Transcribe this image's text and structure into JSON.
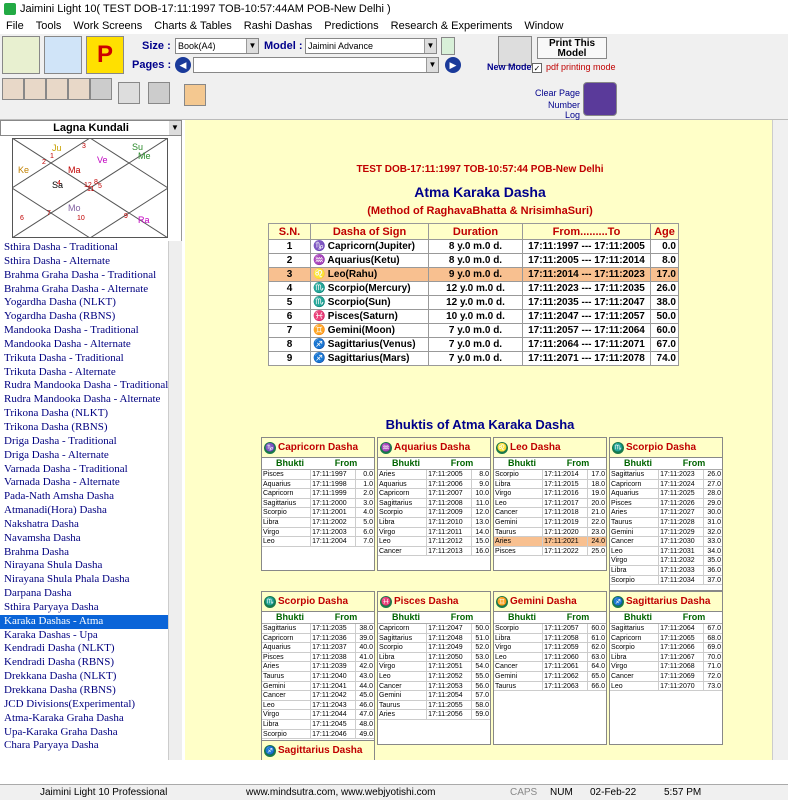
{
  "window": {
    "title": "Jaimini Light 10( TEST DOB-17:11:1997 TOB-10:57:44AM POB-New Delhi )"
  },
  "menu": [
    "File",
    "Tools",
    "Work Screens",
    "Charts & Tables",
    "Rashi Dashas",
    "Predictions",
    "Research & Experiments",
    "Window"
  ],
  "toolbar": {
    "size_label": "Size :",
    "size_value": "Book(A4)",
    "model_label": "Model :",
    "model_value": "Jaimini Advance",
    "pages_label": "Pages :",
    "print_label": "Print This Model",
    "new_model": "New Model",
    "pdf_label": "pdf printing mode",
    "clear_page": "Clear Page",
    "number_log": "Number Log"
  },
  "sidebar": {
    "lagna": "Lagna Kundali",
    "planets": [
      "Ju",
      "Su",
      "Me",
      "Ve",
      "Ke",
      "Ma",
      "Sa",
      "Mo",
      "Ra"
    ],
    "houses": [
      "3",
      "1",
      "2",
      "4",
      "12",
      "8",
      "5",
      "11",
      "6",
      "10",
      "7",
      "9"
    ],
    "dashas": [
      "Sthira Dasha - Traditional",
      "Sthira Dasha - Alternate",
      "Brahma Graha Dasha - Traditional",
      "Brahma Graha Dasha - Alternate",
      "Yogardha Dasha (NLKT)",
      "Yogardha Dasha (RBNS)",
      "Mandooka Dasha - Traditional",
      "Mandooka Dasha - Alternate",
      "Trikuta Dasha - Traditional",
      "Trikuta Dasha - Alternate",
      "Rudra Mandooka Dasha - Traditional",
      "Rudra Mandooka Dasha - Alternate",
      "Trikona Dasha (NLKT)",
      "Trikona Dasha (RBNS)",
      "Driga Dasha - Traditional",
      "Driga Dasha - Alternate",
      "Varnada Dasha - Traditional",
      "Varnada Dasha - Alternate",
      "Pada-Nath Amsha Dasha",
      "Atmanadi(Hora) Dasha",
      "Nakshatra Dasha",
      "Navamsha Dasha",
      "Brahma Dasha",
      "Nirayana Shula Dasha",
      "Nirayana Shula Phala Dasha",
      "Darpana Dasha",
      "Sthira Paryaya Dasha",
      "Karaka Dashas - Atma",
      "Karaka Dashas - Upa",
      "Kendradi Dasha (NLKT)",
      "Kendradi Dasha (RBNS)",
      "Drekkana Dasha (NLKT)",
      "Drekkana Dasha (RBNS)",
      "JCD Divisions(Experimental)",
      "Atma-Karaka Graha Dasha",
      "Upa-Karaka Graha Dasha",
      "Chara Paryaya Dasha"
    ],
    "selected": 27
  },
  "main": {
    "test_line": "TEST DOB-17:11:1997 TOB-10:57:44 POB-New Delhi",
    "title": "Atma Karaka Dasha",
    "method": "(Method of RaghavaBhatta & NrisimhaSuri)",
    "cols": [
      "S.N.",
      "Dasha of Sign",
      "Duration",
      "From.........To",
      "Age"
    ],
    "rows": [
      {
        "sn": "1",
        "sym": "♑",
        "sign": "Capricorn(Jupiter)",
        "dur": "8 y.0 m.0 d.",
        "range": "17:11:1997 --- 17:11:2005",
        "age": "0.0"
      },
      {
        "sn": "2",
        "sym": "♒",
        "sign": "Aquarius(Ketu)",
        "dur": "8 y.0 m.0 d.",
        "range": "17:11:2005 --- 17:11:2014",
        "age": "8.0"
      },
      {
        "sn": "3",
        "sym": "♌",
        "sign": "Leo(Rahu)",
        "dur": "9 y.0 m.0 d.",
        "range": "17:11:2014 --- 17:11:2023",
        "age": "17.0"
      },
      {
        "sn": "4",
        "sym": "♏",
        "sign": "Scorpio(Mercury)",
        "dur": "12 y.0 m.0 d.",
        "range": "17:11:2023 --- 17:11:2035",
        "age": "26.0"
      },
      {
        "sn": "5",
        "sym": "♏",
        "sign": "Scorpio(Sun)",
        "dur": "12 y.0 m.0 d.",
        "range": "17:11:2035 --- 17:11:2047",
        "age": "38.0"
      },
      {
        "sn": "6",
        "sym": "♓",
        "sign": "Pisces(Saturn)",
        "dur": "10 y.0 m.0 d.",
        "range": "17:11:2047 --- 17:11:2057",
        "age": "50.0"
      },
      {
        "sn": "7",
        "sym": "♊",
        "sign": "Gemini(Moon)",
        "dur": "7 y.0 m.0 d.",
        "range": "17:11:2057 --- 17:11:2064",
        "age": "60.0"
      },
      {
        "sn": "8",
        "sym": "♐",
        "sign": "Sagittarius(Venus)",
        "dur": "7 y.0 m.0 d.",
        "range": "17:11:2064 --- 17:11:2071",
        "age": "67.0"
      },
      {
        "sn": "9",
        "sym": "♐",
        "sign": "Sagittarius(Mars)",
        "dur": "7 y.0 m.0 d.",
        "range": "17:11:2071 --- 17:11:2078",
        "age": "74.0"
      }
    ],
    "highlight_row": 2,
    "bhuktis_title": "Bhuktis of Atma Karaka Dasha",
    "bh_head": [
      "Bhukti",
      "From"
    ],
    "blocks": [
      {
        "title": "Capricorn Dasha",
        "icon": "♑",
        "rows": [
          [
            "Pisces",
            "17:11:1997",
            "0.0"
          ],
          [
            "Aquarius",
            "17:11:1998",
            "1.0"
          ],
          [
            "Capricorn",
            "17:11:1999",
            "2.0"
          ],
          [
            "Sagittarius",
            "17:11:2000",
            "3.0"
          ],
          [
            "Scorpio",
            "17:11:2001",
            "4.0"
          ],
          [
            "Libra",
            "17:11:2002",
            "5.0"
          ],
          [
            "Virgo",
            "17:11:2003",
            "6.0"
          ],
          [
            "Leo",
            "17:11:2004",
            "7.0"
          ]
        ]
      },
      {
        "title": "Aquarius Dasha",
        "icon": "♒",
        "rows": [
          [
            "Aries",
            "17:11:2005",
            "8.0"
          ],
          [
            "Aquarius",
            "17:11:2006",
            "9.0"
          ],
          [
            "Capricorn",
            "17:11:2007",
            "10.0"
          ],
          [
            "Sagittarius",
            "17:11:2008",
            "11.0"
          ],
          [
            "Scorpio",
            "17:11:2009",
            "12.0"
          ],
          [
            "Libra",
            "17:11:2010",
            "13.0"
          ],
          [
            "Virgo",
            "17:11:2011",
            "14.0"
          ],
          [
            "Leo",
            "17:11:2012",
            "15.0"
          ],
          [
            "Cancer",
            "17:11:2013",
            "16.0"
          ]
        ]
      },
      {
        "title": "Leo Dasha",
        "icon": "♌",
        "rows": [
          [
            "Scorpio",
            "17:11:2014",
            "17.0"
          ],
          [
            "Libra",
            "17:11:2015",
            "18.0"
          ],
          [
            "Virgo",
            "17:11:2016",
            "19.0"
          ],
          [
            "Leo",
            "17:11:2017",
            "20.0"
          ],
          [
            "Cancer",
            "17:11:2018",
            "21.0"
          ],
          [
            "Gemini",
            "17:11:2019",
            "22.0"
          ],
          [
            "Taurus",
            "17:11:2020",
            "23.0"
          ],
          [
            "Aries",
            "17:11:2021",
            "24.0"
          ],
          [
            "Pisces",
            "17:11:2022",
            "25.0"
          ]
        ],
        "hl": 7
      },
      {
        "title": "Scorpio Dasha",
        "icon": "♏",
        "rows": [
          [
            "Sagittarius",
            "17:11:2023",
            "26.0"
          ],
          [
            "Capricorn",
            "17:11:2024",
            "27.0"
          ],
          [
            "Aquarius",
            "17:11:2025",
            "28.0"
          ],
          [
            "Pisces",
            "17:11:2026",
            "29.0"
          ],
          [
            "Aries",
            "17:11:2027",
            "30.0"
          ],
          [
            "Taurus",
            "17:11:2028",
            "31.0"
          ],
          [
            "Gemini",
            "17:11:2029",
            "32.0"
          ],
          [
            "Cancer",
            "17:11:2030",
            "33.0"
          ],
          [
            "Leo",
            "17:11:2031",
            "34.0"
          ],
          [
            "Virgo",
            "17:11:2032",
            "35.0"
          ],
          [
            "Libra",
            "17:11:2033",
            "36.0"
          ],
          [
            "Scorpio",
            "17:11:2034",
            "37.0"
          ]
        ]
      },
      {
        "title": "Scorpio Dasha",
        "icon": "♏",
        "rows": [
          [
            "Sagittarius",
            "17:11:2035",
            "38.0"
          ],
          [
            "Capricorn",
            "17:11:2036",
            "39.0"
          ],
          [
            "Aquarius",
            "17:11:2037",
            "40.0"
          ],
          [
            "Pisces",
            "17:11:2038",
            "41.0"
          ],
          [
            "Aries",
            "17:11:2039",
            "42.0"
          ],
          [
            "Taurus",
            "17:11:2040",
            "43.0"
          ],
          [
            "Gemini",
            "17:11:2041",
            "44.0"
          ],
          [
            "Cancer",
            "17:11:2042",
            "45.0"
          ],
          [
            "Leo",
            "17:11:2043",
            "46.0"
          ],
          [
            "Virgo",
            "17:11:2044",
            "47.0"
          ],
          [
            "Libra",
            "17:11:2045",
            "48.0"
          ],
          [
            "Scorpio",
            "17:11:2046",
            "49.0"
          ]
        ]
      },
      {
        "title": "Pisces Dasha",
        "icon": "♓",
        "rows": [
          [
            "Capricorn",
            "17:11:2047",
            "50.0"
          ],
          [
            "Sagittarius",
            "17:11:2048",
            "51.0"
          ],
          [
            "Scorpio",
            "17:11:2049",
            "52.0"
          ],
          [
            "Libra",
            "17:11:2050",
            "53.0"
          ],
          [
            "Virgo",
            "17:11:2051",
            "54.0"
          ],
          [
            "Leo",
            "17:11:2052",
            "55.0"
          ],
          [
            "Cancer",
            "17:11:2053",
            "56.0"
          ],
          [
            "Gemini",
            "17:11:2054",
            "57.0"
          ],
          [
            "Taurus",
            "17:11:2055",
            "58.0"
          ],
          [
            "Aries",
            "17:11:2056",
            "59.0"
          ]
        ]
      },
      {
        "title": "Gemini Dasha",
        "icon": "♊",
        "rows": [
          [
            "Scorpio",
            "17:11:2057",
            "60.0"
          ],
          [
            "Libra",
            "17:11:2058",
            "61.0"
          ],
          [
            "Virgo",
            "17:11:2059",
            "62.0"
          ],
          [
            "Leo",
            "17:11:2060",
            "63.0"
          ],
          [
            "Cancer",
            "17:11:2061",
            "64.0"
          ],
          [
            "Gemini",
            "17:11:2062",
            "65.0"
          ],
          [
            "Taurus",
            "17:11:2063",
            "66.0"
          ]
        ]
      },
      {
        "title": "Sagittarius Dasha",
        "icon": "♐",
        "rows": [
          [
            "Sagittarius",
            "17:11:2064",
            "67.0"
          ],
          [
            "Capricorn",
            "17:11:2065",
            "68.0"
          ],
          [
            "Scorpio",
            "17:11:2066",
            "69.0"
          ],
          [
            "Libra",
            "17:11:2067",
            "70.0"
          ],
          [
            "Virgo",
            "17:11:2068",
            "71.0"
          ],
          [
            "Cancer",
            "17:11:2069",
            "72.0"
          ],
          [
            "Leo",
            "17:11:2070",
            "73.0"
          ]
        ]
      },
      {
        "title": "Sagittarius Dasha",
        "icon": "♐",
        "rows": []
      }
    ]
  },
  "status": {
    "app": "Jaimini Light 10 Professional",
    "web": "www.mindsutra.com, www.webjyotishi.com",
    "caps": "CAPS",
    "num": "NUM",
    "date": "02-Feb-22",
    "time": "5:57 PM"
  }
}
